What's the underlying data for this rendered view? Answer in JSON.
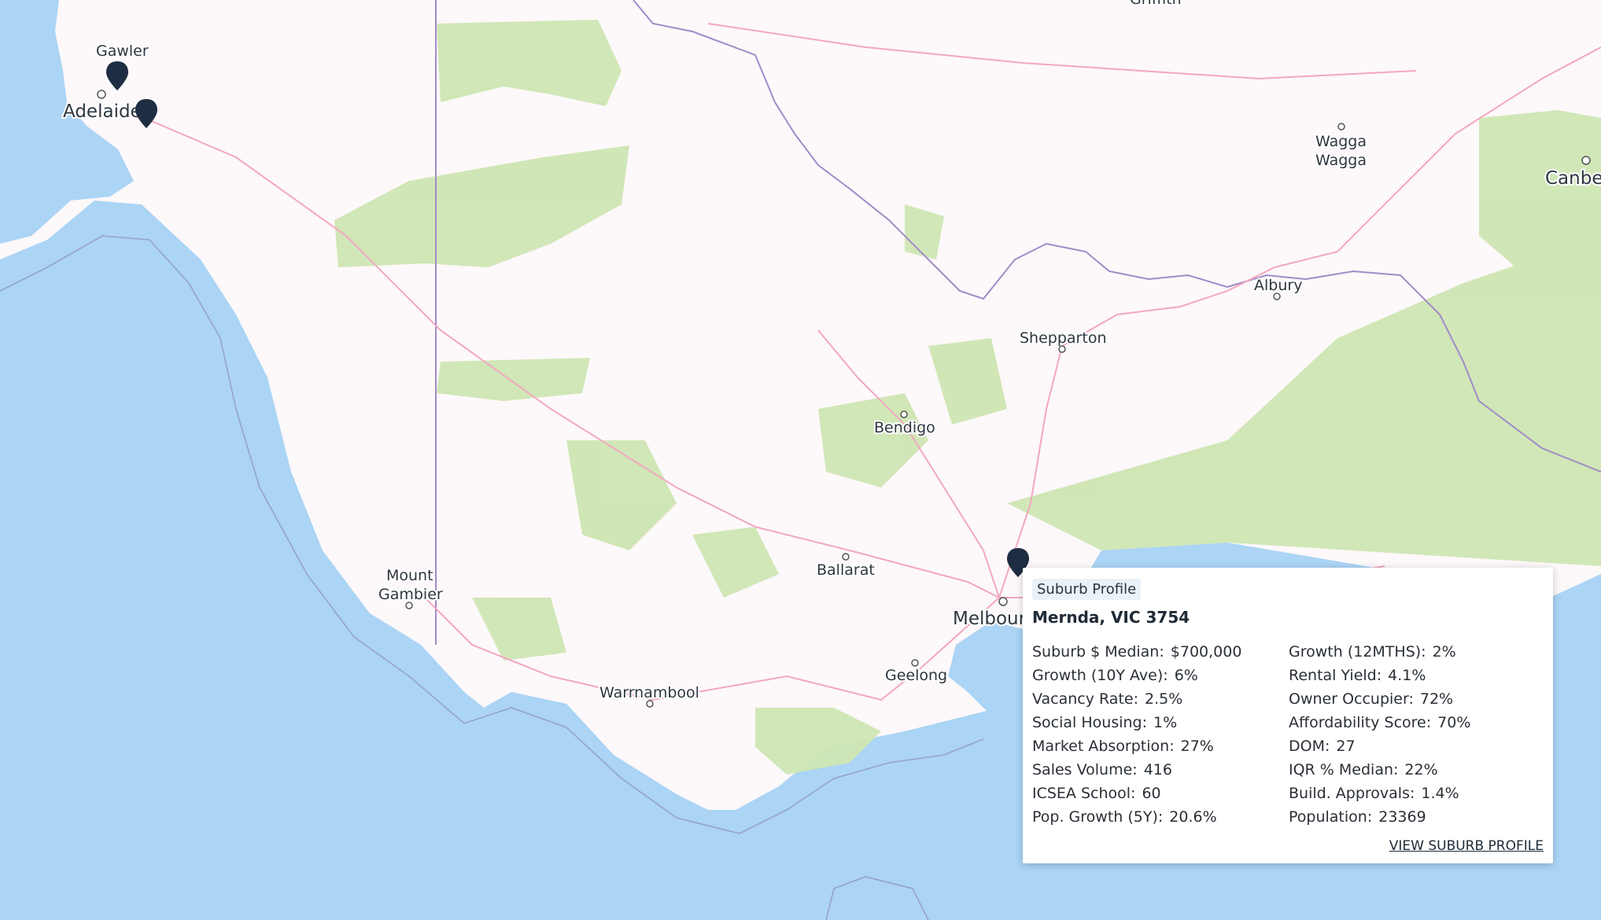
{
  "map": {
    "colors": {
      "sea": "#abd4f5",
      "land": "#fdf8fa",
      "forest": "#cfe6b3",
      "roads": "#f2a7c0",
      "border": "#a08cc8"
    },
    "labels": {
      "gawler": "Gawler",
      "adelaide": "Adelaide",
      "wagga1": "Wagga",
      "wagga2": "Wagga",
      "canberra": "Canbe",
      "albury": "Albury",
      "shepparton": "Shepparton",
      "bendigo": "Bendigo",
      "ballarat": "Ballarat",
      "melbourne": "Melbour",
      "geelong": "Geelong",
      "mount": "Mount",
      "gambier": "Gambier",
      "warrnambool": "Warrnambool",
      "griffith": "Griffith"
    },
    "markers": [
      {
        "name": "Gawler"
      },
      {
        "name": "Adelaide"
      },
      {
        "name": "Mernda"
      }
    ]
  },
  "popup": {
    "tag": "Suburb Profile",
    "title": "Mernda, VIC 3754",
    "stats_left": [
      {
        "label": "Suburb $ Median:",
        "value": "$700,000"
      },
      {
        "label": "Growth (10Y Ave):",
        "value": "6%"
      },
      {
        "label": "Vacancy Rate:",
        "value": "2.5%"
      },
      {
        "label": "Social Housing:",
        "value": "1%"
      },
      {
        "label": "Market Absorption:",
        "value": "27%"
      },
      {
        "label": "Sales Volume:",
        "value": "416"
      },
      {
        "label": "ICSEA School:",
        "value": "60"
      },
      {
        "label": "Pop. Growth (5Y):",
        "value": "20.6%"
      }
    ],
    "stats_right": [
      {
        "label": "Growth (12MTHS):",
        "value": "2%"
      },
      {
        "label": "Rental Yield:",
        "value": "4.1%"
      },
      {
        "label": "Owner Occupier:",
        "value": "72%"
      },
      {
        "label": "Affordability Score:",
        "value": "70%"
      },
      {
        "label": "DOM:",
        "value": "27"
      },
      {
        "label": "IQR % Median:",
        "value": "22%"
      },
      {
        "label": "Build. Approvals:",
        "value": "1.4%"
      },
      {
        "label": "Population:",
        "value": "23369"
      }
    ],
    "link": "VIEW SUBURB PROFILE"
  }
}
